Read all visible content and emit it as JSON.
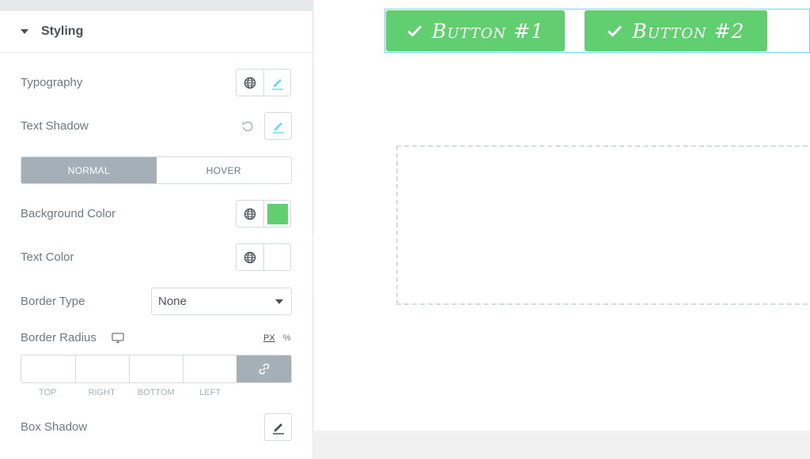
{
  "panel": {
    "section_title": "Styling",
    "typography_label": "Typography",
    "text_shadow_label": "Text Shadow",
    "state_tabs": [
      "NORMAL",
      "HOVER"
    ],
    "background_color_label": "Background Color",
    "background_color_value": "#61ce70",
    "text_color_label": "Text Color",
    "border_type_label": "Border Type",
    "border_type_value": "None",
    "border_radius_label": "Border Radius",
    "units": [
      "PX",
      "%"
    ],
    "dimension_labels": [
      "TOP",
      "RIGHT",
      "BOTTOM",
      "LEFT"
    ],
    "box_shadow_label": "Box Shadow"
  },
  "canvas": {
    "buttons": [
      {
        "label": "Button #1"
      },
      {
        "label": "Button #2"
      }
    ]
  },
  "colors": {
    "accent_green": "#61ce70",
    "edit_blue": "#71d7f7",
    "active_tab": "#a4afb7"
  },
  "icons": {
    "global": "globe-icon",
    "edit": "pencil-icon",
    "reset": "reset-icon",
    "device": "desktop-icon",
    "link": "link-icon",
    "check": "check-icon"
  }
}
